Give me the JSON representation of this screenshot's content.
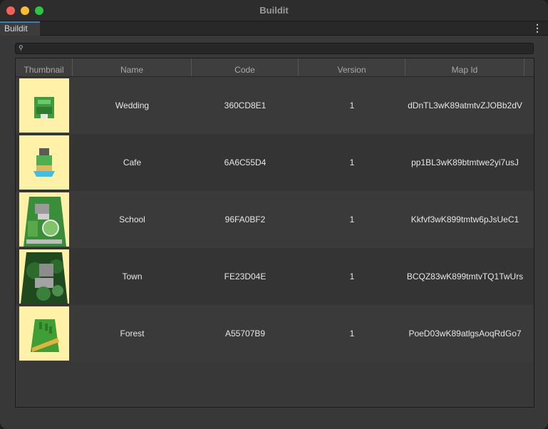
{
  "window": {
    "title": "Buildit"
  },
  "tabs": [
    {
      "label": "Buildit"
    }
  ],
  "search": {
    "placeholder": ""
  },
  "table": {
    "columns": [
      "Thumbnail",
      "Name",
      "Code",
      "Version",
      "Map Id"
    ],
    "rows": [
      {
        "name": "Wedding",
        "code": "360CD8E1",
        "version": "1",
        "map_id": "dDnTL3wK89atmtvZJOBb2dV",
        "thumbnail": "wedding-thumbnail"
      },
      {
        "name": "Cafe",
        "code": "6A6C55D4",
        "version": "1",
        "map_id": "pp1BL3wK89btmtwe2yi7usJ",
        "thumbnail": "cafe-thumbnail"
      },
      {
        "name": "School",
        "code": "96FA0BF2",
        "version": "1",
        "map_id": "Kkfvf3wK899tmtw6pJsUeC1",
        "thumbnail": "school-thumbnail"
      },
      {
        "name": "Town",
        "code": "FE23D04E",
        "version": "1",
        "map_id": "BCQZ83wK899tmtvTQ1TwUrs",
        "thumbnail": "town-thumbnail"
      },
      {
        "name": "Forest",
        "code": "A55707B9",
        "version": "1",
        "map_id": "PoeD03wK89atlgsAoqRdGo7",
        "thumbnail": "forest-thumbnail"
      }
    ]
  },
  "colors": {
    "tab_accent": "#3d7eb3",
    "thumbnail_bg": "#fff1a8"
  }
}
